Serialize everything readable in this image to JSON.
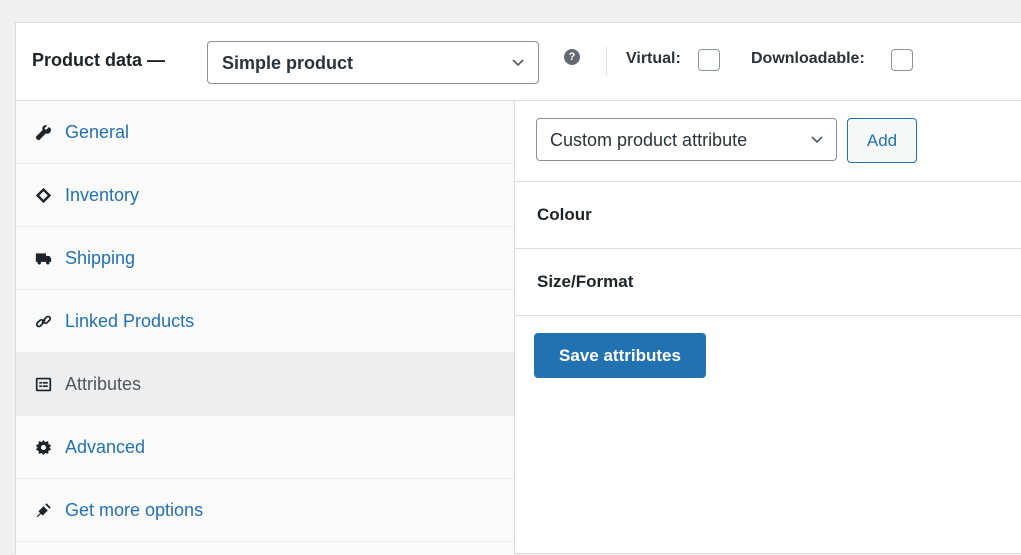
{
  "header": {
    "title": "Product data —",
    "product_type": "Simple product",
    "help_icon": "help-icon",
    "virtual_label": "Virtual:",
    "downloadable_label": "Downloadable:"
  },
  "sidebar": {
    "items": [
      {
        "label": "General",
        "icon": "wrench-icon",
        "active": false
      },
      {
        "label": "Inventory",
        "icon": "tag-icon",
        "active": false
      },
      {
        "label": "Shipping",
        "icon": "truck-icon",
        "active": false
      },
      {
        "label": "Linked Products",
        "icon": "link-icon",
        "active": false
      },
      {
        "label": "Attributes",
        "icon": "list-icon",
        "active": true
      },
      {
        "label": "Advanced",
        "icon": "gear-icon",
        "active": false
      },
      {
        "label": "Get more options",
        "icon": "plugin-icon",
        "active": false
      }
    ]
  },
  "attributes": {
    "select_value": "Custom product attribute",
    "add_label": "Add",
    "rows": [
      "Colour",
      "Size/Format"
    ],
    "save_label": "Save attributes"
  },
  "colors": {
    "accent": "#2271b1",
    "active_bg": "#eeeeee"
  }
}
